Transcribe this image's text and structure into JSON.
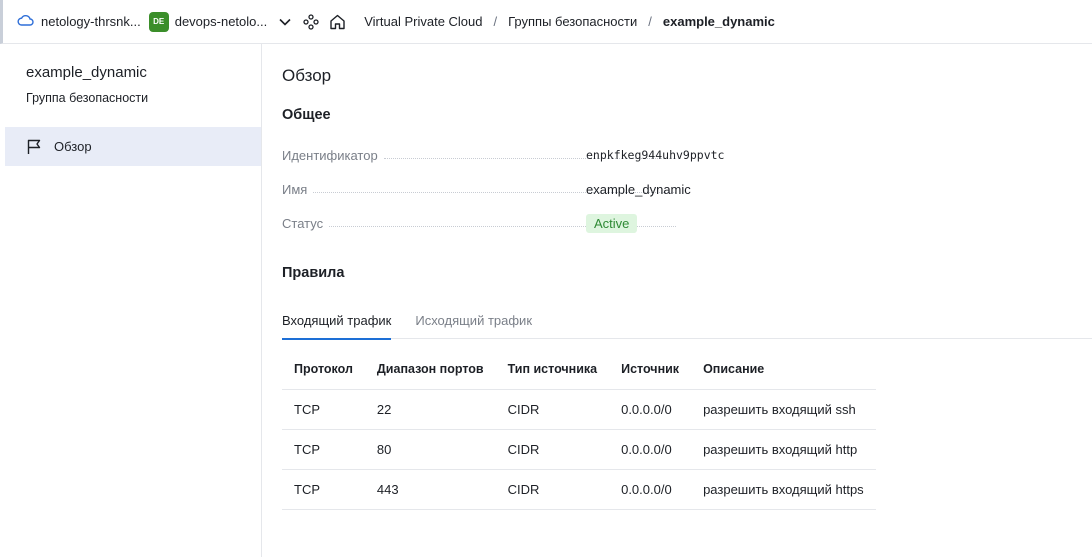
{
  "topbar": {
    "cloud_label": "netology-thrsnk...",
    "folder_badge": "DE",
    "folder_label": "devops-netolo...",
    "folder_badge_color": "#3b8e2a",
    "breadcrumbs": [
      "Virtual Private Cloud",
      "Группы безопасности",
      "example_dynamic"
    ],
    "separator": "/"
  },
  "sidebar": {
    "title": "example_dynamic",
    "subtitle": "Группа безопасности",
    "items": [
      {
        "label": "Обзор",
        "icon": "flag-icon",
        "active": true
      }
    ]
  },
  "main": {
    "page_title": "Обзор",
    "general_title": "Общее",
    "properties": [
      {
        "key": "Идентификатор",
        "value": "enpkfkeg944uhv9ppvtc"
      },
      {
        "key": "Имя",
        "value": "example_dynamic"
      },
      {
        "key": "Статус",
        "value": "Active"
      }
    ],
    "status_color": "#2f8a35",
    "rules_title": "Правила",
    "tabs": [
      {
        "label": "Входящий трафик",
        "active": true
      },
      {
        "label": "Исходящий трафик",
        "active": false
      }
    ],
    "table": {
      "columns": [
        "Протокол",
        "Диапазон портов",
        "Тип источника",
        "Источник",
        "Описание"
      ],
      "rows": [
        [
          "TCP",
          "22",
          "CIDR",
          "0.0.0.0/0",
          "разрешить входящий ssh"
        ],
        [
          "TCP",
          "80",
          "CIDR",
          "0.0.0.0/0",
          "разрешить входящий http"
        ],
        [
          "TCP",
          "443",
          "CIDR",
          "0.0.0.0/0",
          "разрешить входящий https"
        ]
      ]
    }
  }
}
